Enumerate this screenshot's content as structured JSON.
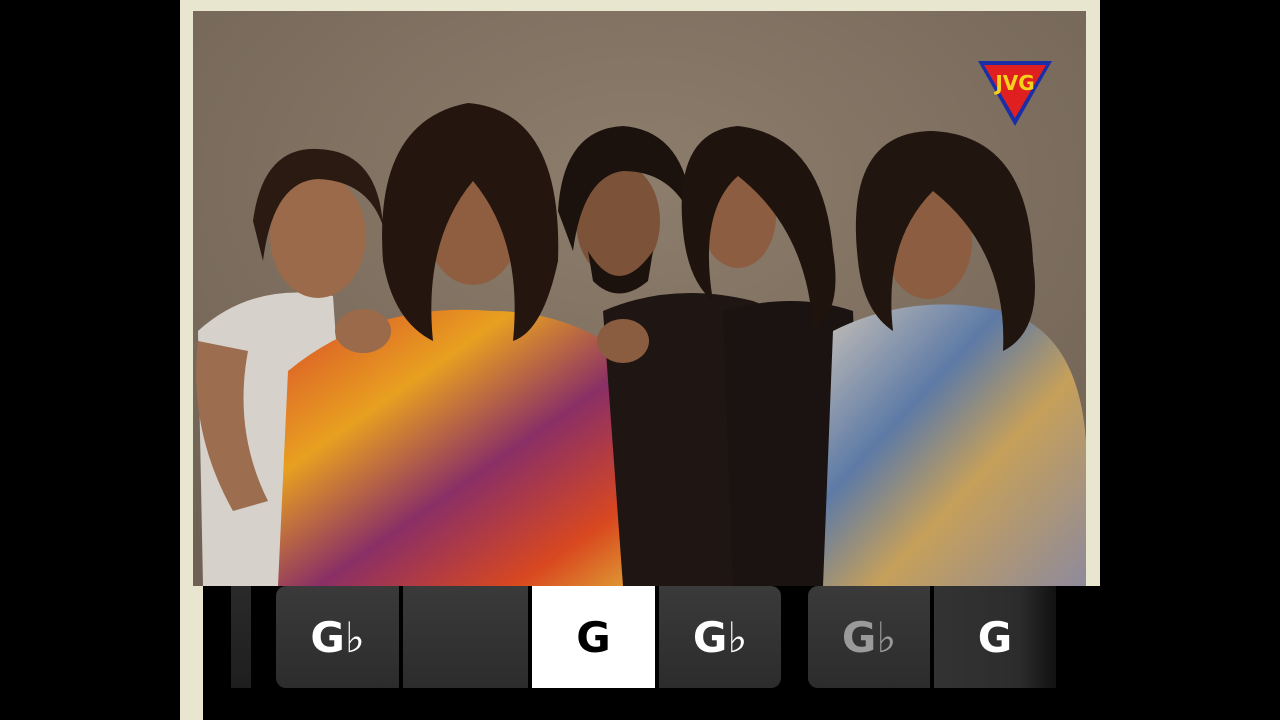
{
  "video": {
    "logo_icon": "jvg-triangle-logo-icon",
    "photo_description_icon": "band-photo-image"
  },
  "chords": {
    "cells": [
      {
        "label": "",
        "state": "empty"
      },
      {
        "label": "G♭",
        "state": "normal"
      },
      {
        "label": "",
        "state": "empty"
      },
      {
        "label": "G",
        "state": "active"
      },
      {
        "label": "G♭",
        "state": "normal"
      },
      {
        "label": "G♭",
        "state": "dim"
      },
      {
        "label": "G",
        "state": "normal"
      }
    ]
  },
  "colors": {
    "frame": "#e9e6cf",
    "background": "#000000",
    "active_cell": "#ffffff",
    "cell": "#333333"
  }
}
